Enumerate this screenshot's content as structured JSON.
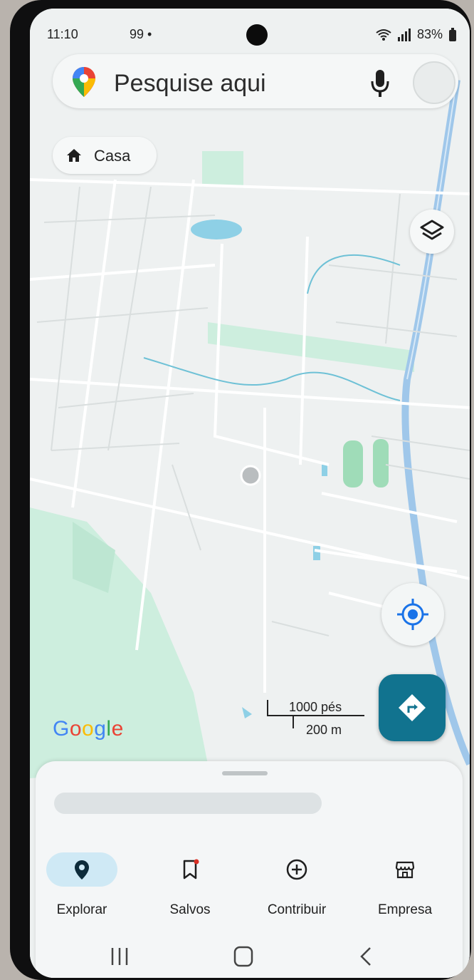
{
  "status_bar": {
    "time": "11:10",
    "notifications": "99 •",
    "battery": "83%"
  },
  "search": {
    "placeholder": "Pesquise aqui",
    "mic_icon": "microphone-icon",
    "account_icon": "account-avatar"
  },
  "shortcut_chip": {
    "label": "Casa",
    "icon": "home-icon"
  },
  "map": {
    "attribution": "Google",
    "scale_feet": "1000 pés",
    "scale_meters": "200 m",
    "controls": [
      "layers-icon",
      "my-location-icon",
      "directions-icon"
    ]
  },
  "bottom_nav": {
    "items": [
      {
        "label": "Explorar",
        "icon": "explore-pin-icon",
        "active": true
      },
      {
        "label": "Salvos",
        "icon": "bookmark-icon",
        "active": false
      },
      {
        "label": "Contribuir",
        "icon": "add-circle-icon",
        "active": false
      },
      {
        "label": "Empresa",
        "icon": "storefront-icon",
        "active": false
      }
    ]
  },
  "colors": {
    "accent": "#11738f",
    "active_tab_bg": "#cfe9f5",
    "map_road": "#ffffff",
    "map_park": "#cdeede",
    "map_water": "#8ed0e6"
  }
}
